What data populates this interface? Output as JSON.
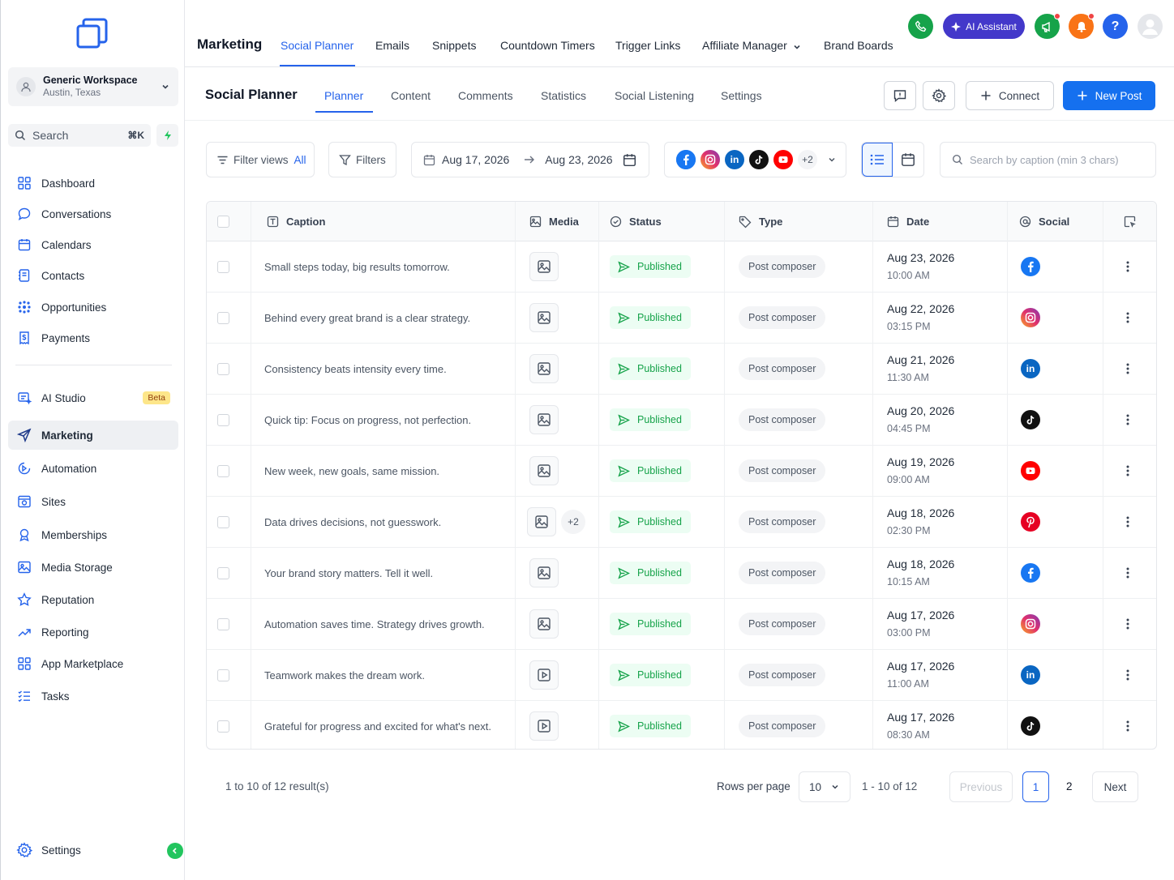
{
  "sidebar": {
    "workspace": {
      "name": "Generic Workspace",
      "location": "Austin, Texas"
    },
    "search": {
      "label": "Search",
      "shortcut": "⌘K"
    },
    "items": [
      {
        "label": "Dashboard"
      },
      {
        "label": "Conversations"
      },
      {
        "label": "Calendars"
      },
      {
        "label": "Contacts"
      },
      {
        "label": "Opportunities"
      },
      {
        "label": "Payments"
      },
      {
        "label": "AI Studio",
        "badge": "Beta"
      },
      {
        "label": "Marketing"
      },
      {
        "label": "Automation"
      },
      {
        "label": "Sites"
      },
      {
        "label": "Memberships"
      },
      {
        "label": "Media Storage"
      },
      {
        "label": "Reputation"
      },
      {
        "label": "Reporting"
      },
      {
        "label": "App Marketplace"
      },
      {
        "label": "Tasks"
      }
    ],
    "settings": "Settings"
  },
  "topbar": {
    "title": "Marketing",
    "tabs": [
      "Social Planner",
      "Emails",
      "Snippets",
      "Countdown Timers",
      "Trigger Links",
      "Affiliate Manager",
      "Brand Boards"
    ],
    "ai_assistant": "AI Assistant",
    "help": "?"
  },
  "subheader": {
    "title": "Social Planner",
    "tabs": [
      "Planner",
      "Content",
      "Comments",
      "Statistics",
      "Social Listening",
      "Settings"
    ],
    "connect": "Connect",
    "new_post": "New Post"
  },
  "filters": {
    "filter_views": "Filter views",
    "filter_views_value": "All",
    "filters": "Filters",
    "date_from": "Aug 17, 2026",
    "date_to": "Aug 23, 2026",
    "social_more": "+2",
    "search_placeholder": "Search by caption (min 3 chars)"
  },
  "table": {
    "headers": {
      "caption": "Caption",
      "media": "Media",
      "status": "Status",
      "type": "Type",
      "date": "Date",
      "social": "Social"
    },
    "rows": [
      {
        "caption": "Small steps today, big results tomorrow.",
        "media": "image",
        "media_more": "",
        "status": "Published",
        "type": "Post composer",
        "date": "Aug 23, 2026",
        "time": "10:00 AM",
        "social": "facebook"
      },
      {
        "caption": "Behind every great brand is a clear strategy.",
        "media": "image",
        "media_more": "",
        "status": "Published",
        "type": "Post composer",
        "date": "Aug 22, 2026",
        "time": "03:15 PM",
        "social": "instagram"
      },
      {
        "caption": "Consistency beats intensity every time.",
        "media": "image",
        "media_more": "",
        "status": "Published",
        "type": "Post composer",
        "date": "Aug 21, 2026",
        "time": "11:30 AM",
        "social": "linkedin"
      },
      {
        "caption": "Quick tip: Focus on progress, not perfection.",
        "media": "image",
        "media_more": "",
        "status": "Published",
        "type": "Post composer",
        "date": "Aug 20, 2026",
        "time": "04:45 PM",
        "social": "tiktok"
      },
      {
        "caption": "New week, new goals, same mission.",
        "media": "image",
        "media_more": "",
        "status": "Published",
        "type": "Post composer",
        "date": "Aug 19, 2026",
        "time": "09:00 AM",
        "social": "youtube"
      },
      {
        "caption": "Data drives decisions, not guesswork.",
        "media": "image",
        "media_more": "+2",
        "status": "Published",
        "type": "Post composer",
        "date": "Aug 18, 2026",
        "time": "02:30 PM",
        "social": "pinterest"
      },
      {
        "caption": "Your brand story matters. Tell it well.",
        "media": "image",
        "media_more": "",
        "status": "Published",
        "type": "Post composer",
        "date": "Aug 18, 2026",
        "time": "10:15 AM",
        "social": "facebook"
      },
      {
        "caption": "Automation saves time. Strategy drives growth.",
        "media": "image",
        "media_more": "",
        "status": "Published",
        "type": "Post composer",
        "date": "Aug 17, 2026",
        "time": "03:00 PM",
        "social": "instagram"
      },
      {
        "caption": "Teamwork makes the dream work.",
        "media": "video",
        "media_more": "",
        "status": "Published",
        "type": "Post composer",
        "date": "Aug 17, 2026",
        "time": "11:00 AM",
        "social": "linkedin"
      },
      {
        "caption": "Grateful for progress and excited for what's next.",
        "media": "video",
        "media_more": "",
        "status": "Published",
        "type": "Post composer",
        "date": "Aug 17, 2026",
        "time": "08:30 AM",
        "social": "tiktok"
      }
    ]
  },
  "pagination": {
    "summary": "1 to 10 of 12 result(s)",
    "rows_per_page_label": "Rows per page",
    "rows_per_page": "10",
    "range": "1 - 10 of 12",
    "previous": "Previous",
    "pages": [
      "1",
      "2"
    ],
    "next": "Next"
  },
  "colors": {
    "accent": "#2563eb",
    "primary_button": "#1570ef",
    "published": "#16a34a",
    "facebook": "#1877f2",
    "instagram": "#e1306c",
    "linkedin": "#0a66c2",
    "tiktok": "#111111",
    "youtube": "#ff0000",
    "pinterest": "#e60023"
  }
}
